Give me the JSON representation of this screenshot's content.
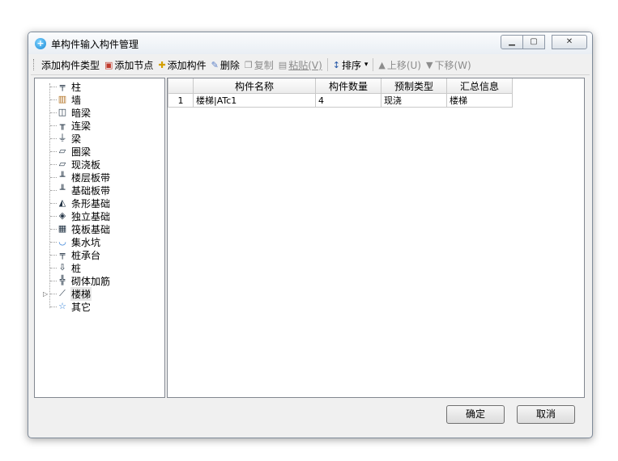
{
  "window": {
    "title": "单构件输入构件管理"
  },
  "toolbar": {
    "add_type": "添加构件类型",
    "add_node": "添加节点",
    "add_component": "添加构件",
    "delete": "删除",
    "copy": "复制",
    "paste": "粘贴(V)",
    "sort": "排序",
    "sort_arrow": "▾",
    "move_up": "上移(U)",
    "move_down": "下移(W)"
  },
  "tree": {
    "items": [
      {
        "label": "柱",
        "icon": "column-icon"
      },
      {
        "label": "墙",
        "icon": "wall-icon"
      },
      {
        "label": "暗梁",
        "icon": "hidden-beam-icon"
      },
      {
        "label": "连梁",
        "icon": "link-beam-icon"
      },
      {
        "label": "梁",
        "icon": "beam-icon"
      },
      {
        "label": "圈梁",
        "icon": "ring-beam-icon"
      },
      {
        "label": "现浇板",
        "icon": "cast-slab-icon"
      },
      {
        "label": "楼层板带",
        "icon": "floor-strip-icon"
      },
      {
        "label": "基础板带",
        "icon": "foundation-strip-icon"
      },
      {
        "label": "条形基础",
        "icon": "strip-foundation-icon"
      },
      {
        "label": "独立基础",
        "icon": "isolated-foundation-icon"
      },
      {
        "label": "筏板基础",
        "icon": "raft-foundation-icon"
      },
      {
        "label": "集水坑",
        "icon": "sump-pit-icon"
      },
      {
        "label": "桩承台",
        "icon": "pile-cap-icon"
      },
      {
        "label": "桩",
        "icon": "pile-icon"
      },
      {
        "label": "砌体加筋",
        "icon": "masonry-rebar-icon"
      },
      {
        "label": "楼梯",
        "icon": "stair-icon"
      },
      {
        "label": "其它",
        "icon": "star-icon"
      }
    ]
  },
  "table": {
    "headers": [
      "构件名称",
      "构件数量",
      "预制类型",
      "汇总信息"
    ],
    "rows": [
      {
        "index": "1",
        "name": "楼梯|ATc1",
        "count": "4",
        "type": "现浇",
        "summary": "楼梯"
      }
    ]
  },
  "buttons": {
    "ok": "确定",
    "cancel": "取消"
  }
}
